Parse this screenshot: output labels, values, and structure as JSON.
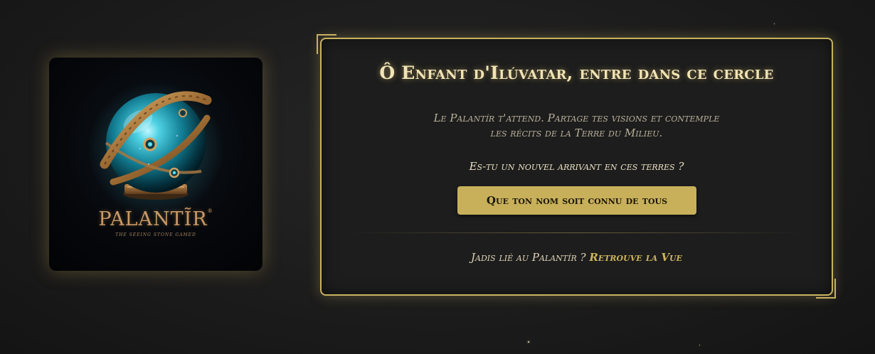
{
  "logo": {
    "title": "PALANTĨR",
    "mark": "®",
    "subtitle": "THE SEEING STONE GAMED",
    "icon": "crystal-orb-icon"
  },
  "panel": {
    "title": "Ô Enfant d'Ilúvatar, entre dans ce cercle",
    "description_line1": "Le Palantír t'attend. Partage tes visions et contemple",
    "description_line2": "les récits de la Terre du Milieu.",
    "question": "Es-tu un nouvel arrivant en ces terres ?",
    "signup_button": "Que ton nom soit connu de tous",
    "login_prompt": "Jadis lié au Palantír ?",
    "login_link": "Retrouve la Vue"
  },
  "colors": {
    "accent_gold": "#c8b260",
    "title_text": "#f1e3b4",
    "background": "#1d1d1d"
  }
}
